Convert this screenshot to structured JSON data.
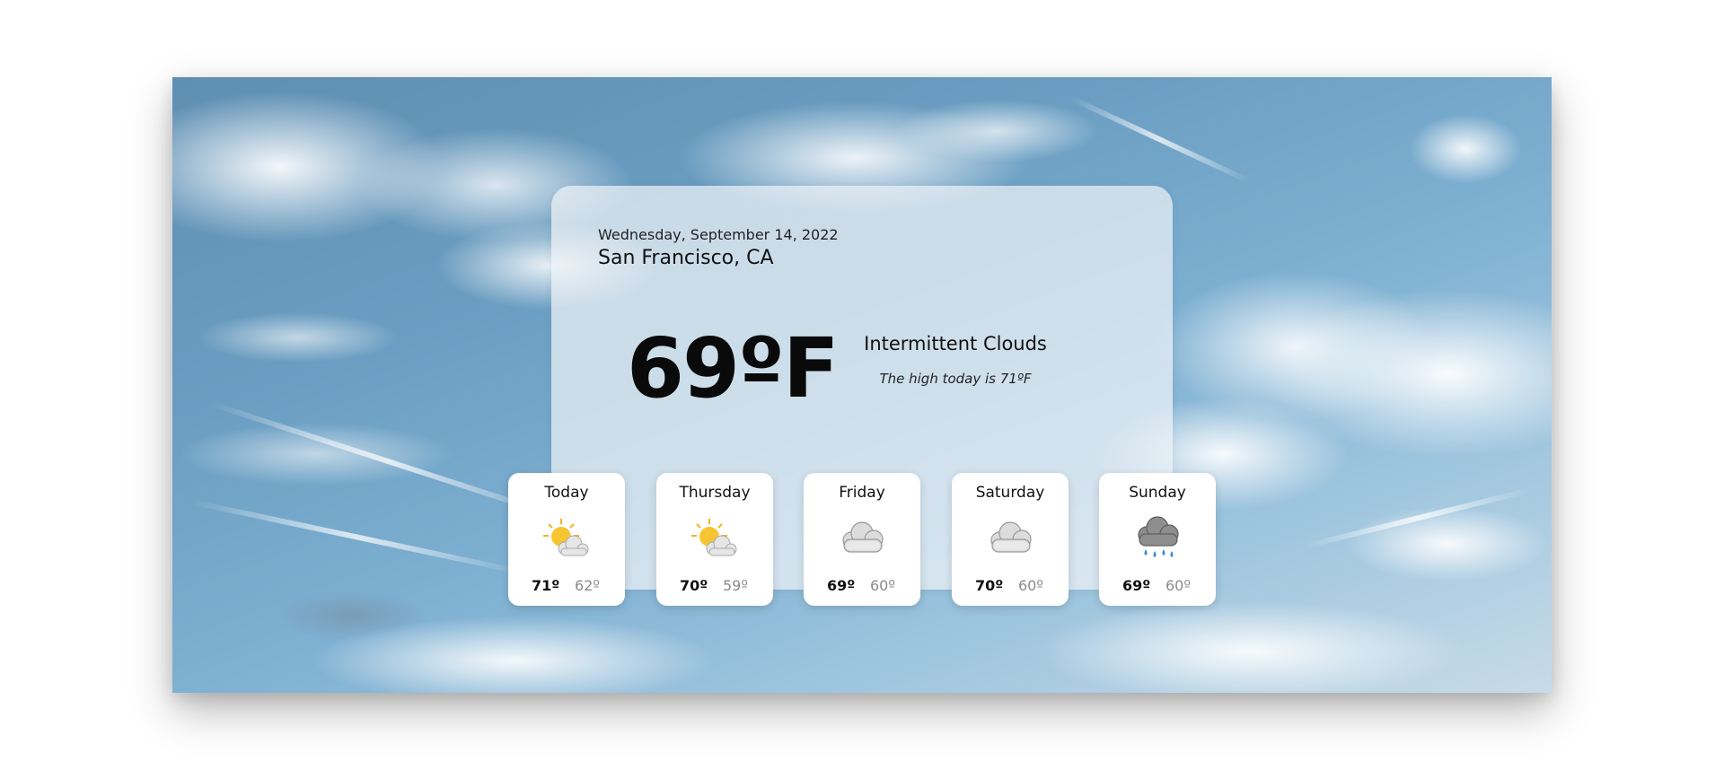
{
  "current": {
    "date": "Wednesday, September 14, 2022",
    "location": "San Francisco, CA",
    "temperature": "69ºF",
    "condition": "Intermittent Clouds",
    "high_note": "The high today is 71ºF"
  },
  "forecast": [
    {
      "day": "Today",
      "icon": "sun-behind-cloud-icon",
      "high": "71º",
      "low": "62º"
    },
    {
      "day": "Thursday",
      "icon": "sun-behind-cloud-icon",
      "high": "70º",
      "low": "59º"
    },
    {
      "day": "Friday",
      "icon": "cloud-icon",
      "high": "69º",
      "low": "60º"
    },
    {
      "day": "Saturday",
      "icon": "cloud-icon",
      "high": "70º",
      "low": "60º"
    },
    {
      "day": "Sunday",
      "icon": "rain-cloud-icon",
      "high": "69º",
      "low": "60º"
    }
  ],
  "colors": {
    "sky": "#6a9dc1",
    "card_glass": "#eef3f7",
    "sun": "#f7c531",
    "low_temp_text": "#8a8a8a"
  }
}
